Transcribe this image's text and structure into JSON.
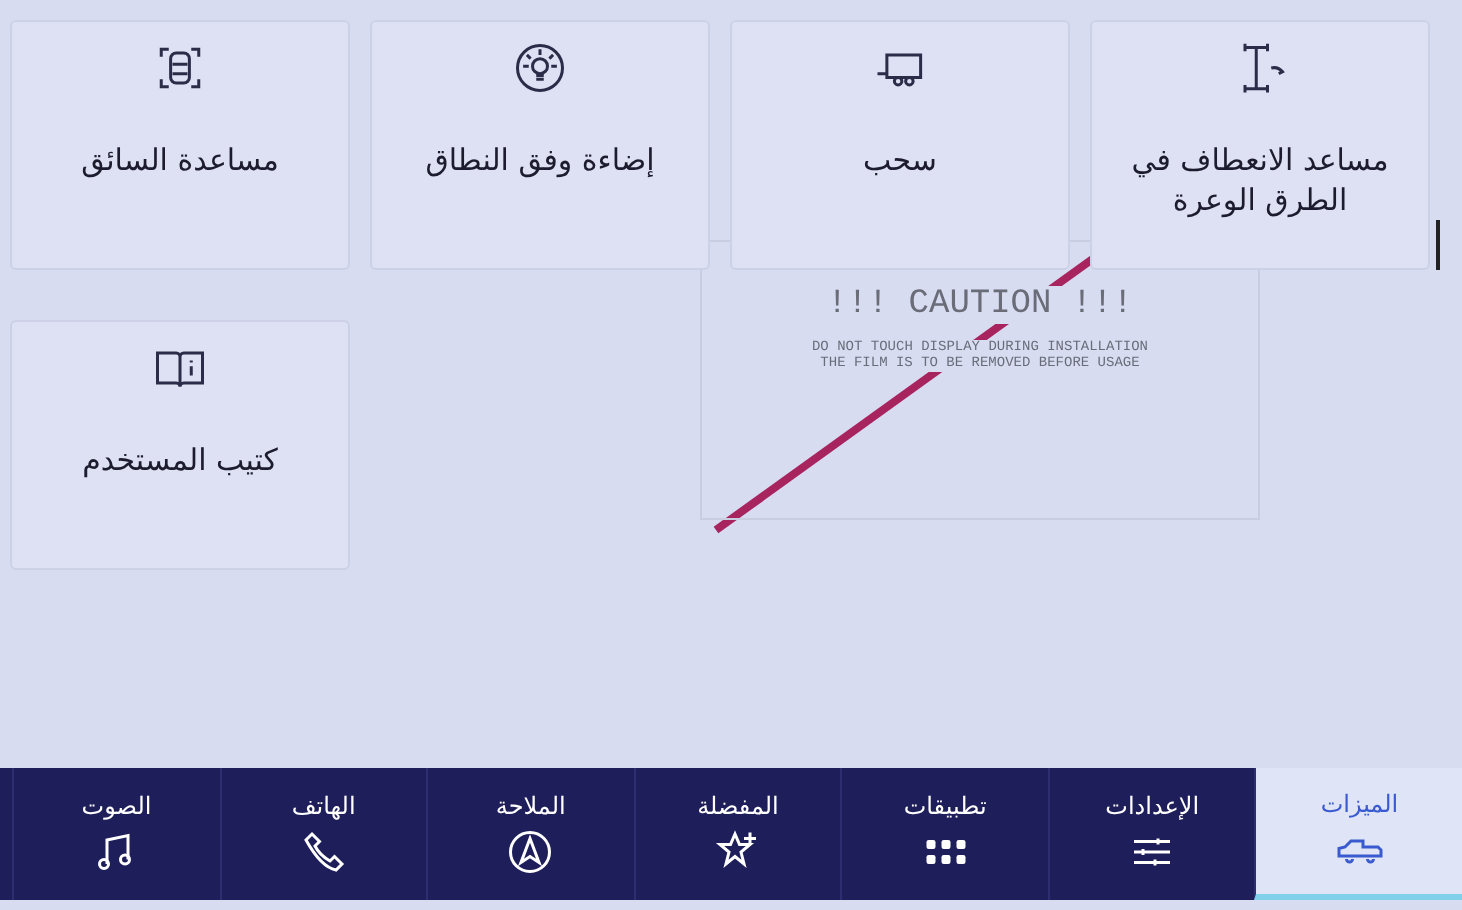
{
  "tiles": [
    {
      "kind": "offroad",
      "label": "مساعد الانعطاف في الطرق الوعرة"
    },
    {
      "kind": "trailer",
      "label": "سحب"
    },
    {
      "kind": "light",
      "label": "إضاءة وفق النطاق"
    },
    {
      "kind": "driver",
      "label": "مساعدة السائق"
    },
    {
      "kind": "book",
      "label": "كتيب المستخدم"
    }
  ],
  "protective_film": {
    "title": "!!! CAUTION !!!",
    "lines": [
      "DO NOT TOUCH DISPLAY DURING INSTALLATION",
      "THE FILM IS TO BE REMOVED BEFORE USAGE"
    ]
  },
  "nav": [
    {
      "kind": "features",
      "label": "الميزات",
      "selected": true
    },
    {
      "kind": "settings",
      "label": "الإعدادات",
      "selected": false
    },
    {
      "kind": "apps",
      "label": "تطبيقات",
      "selected": false
    },
    {
      "kind": "favorites",
      "label": "المفضلة",
      "selected": false
    },
    {
      "kind": "navigation",
      "label": "الملاحة",
      "selected": false
    },
    {
      "kind": "phone",
      "label": "الهاتف",
      "selected": false
    },
    {
      "kind": "music",
      "label": "الصوت",
      "selected": false
    }
  ]
}
